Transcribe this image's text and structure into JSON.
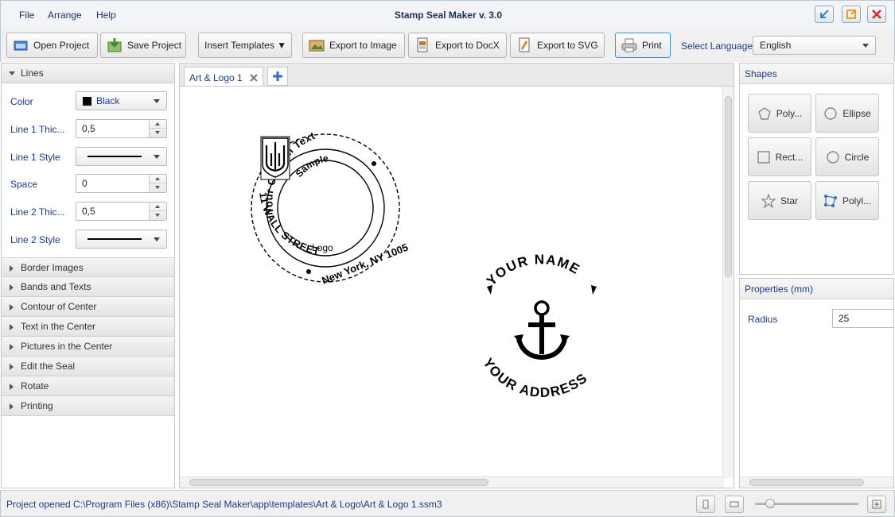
{
  "window": {
    "title": "Stamp Seal Maker v. 3.0"
  },
  "menu": {
    "file": "File",
    "arrange": "Arrange",
    "help": "Help"
  },
  "toolbar": {
    "open_project": "Open Project",
    "save_project": "Save Project",
    "insert_templates": "Insert Templates ▼",
    "export_image": "Export to Image",
    "export_docx": "Export to DocX",
    "export_svg": "Export to SVG",
    "print": "Print",
    "select_language_label": "Select Language",
    "language_value": "English"
  },
  "left_panel": {
    "lines_section": "Lines",
    "color_label": "Color",
    "color_value": "Black",
    "line1_thickness_label": "Line 1 Thic...",
    "line1_thickness_value": "0,5",
    "line1_style_label": "Line 1 Style",
    "space_label": "Space",
    "space_value": "0",
    "line2_thickness_label": "Line 2 Thic...",
    "line2_thickness_value": "0,5",
    "line2_style_label": "Line 2 Style",
    "sections": [
      "Border Images",
      "Bands and Texts",
      "Contour of Center",
      "Text in the Center",
      "Pictures in the Center",
      "Edit the Seal",
      "Rotate",
      "Printing"
    ]
  },
  "tabs": {
    "active_tab": "Art & Logo 1"
  },
  "seal1": {
    "outer_text": "Your Custom Text",
    "bottom_text_left": "11 WALL STREET",
    "bottom_text_right": "New York, NY 1005",
    "inner_top": "Sample",
    "inner_bottom": "Logo"
  },
  "seal2": {
    "top_text": "YOUR NAME",
    "bottom_text": "YOUR ADDRESS"
  },
  "shapes_panel": {
    "title": "Shapes",
    "polygon": "Poly...",
    "ellipse": "Ellipse",
    "rectangle": "Rect...",
    "circle": "Circle",
    "star": "Star",
    "polyline": "Polyl..."
  },
  "properties_panel": {
    "title": "Properties (mm)",
    "radius_label": "Radius",
    "radius_value": "25"
  },
  "status": {
    "text": "Project opened C:\\Program Files (x86)\\Stamp Seal Maker\\app\\templates\\Art & Logo\\Art & Logo 1.ssm3"
  }
}
